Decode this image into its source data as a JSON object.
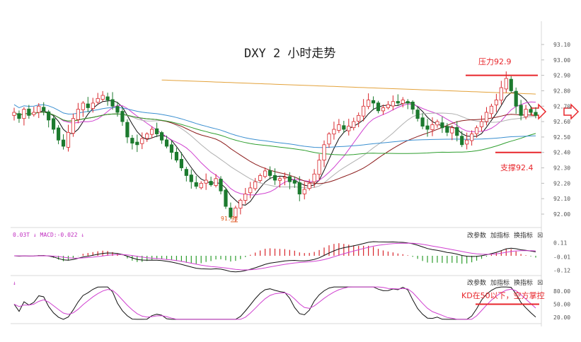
{
  "chart_data": {
    "type": "candlestick",
    "title": "DXY 2 小时走势",
    "yticks": [
      "93.10",
      "93.00",
      "92.90",
      "92.80",
      "92.70",
      "92.60",
      "92.50",
      "92.40",
      "92.30",
      "92.20",
      "92.10",
      "92.00"
    ],
    "ylim": [
      91.93,
      93.13
    ],
    "low_label": "91.95",
    "annotations": {
      "resistance": {
        "label": "压力92.9",
        "value": 92.9
      },
      "support": {
        "label": "支撑92.4",
        "value": 92.4
      },
      "kd_note": {
        "label": "KD在50以下，空方掌控",
        "value": 50
      }
    },
    "closes": [
      92.66,
      92.62,
      92.68,
      92.64,
      92.66,
      92.7,
      92.67,
      92.61,
      92.55,
      92.48,
      92.44,
      92.53,
      92.62,
      92.68,
      92.72,
      92.69,
      92.72,
      92.75,
      92.77,
      92.74,
      92.7,
      92.66,
      92.6,
      92.5,
      92.46,
      92.45,
      92.49,
      92.52,
      92.55,
      92.52,
      92.48,
      92.44,
      92.4,
      92.35,
      92.3,
      92.25,
      92.21,
      92.18,
      92.2,
      92.22,
      92.19,
      92.23,
      92.15,
      92.05,
      91.98,
      92.04,
      92.09,
      92.13,
      92.17,
      92.21,
      92.25,
      92.28,
      92.25,
      92.22,
      92.23,
      92.24,
      92.21,
      92.2,
      92.13,
      92.16,
      92.2,
      92.26,
      92.35,
      92.45,
      92.52,
      92.55,
      92.58,
      92.55,
      92.57,
      92.6,
      92.64,
      92.7,
      92.74,
      92.72,
      92.67,
      92.69,
      92.71,
      92.73,
      92.72,
      92.74,
      92.72,
      92.68,
      92.62,
      92.57,
      92.55,
      92.58,
      92.6,
      92.56,
      92.53,
      92.56,
      92.51,
      92.45,
      92.48,
      92.52,
      92.56,
      92.6,
      92.66,
      92.7,
      92.74,
      92.82,
      92.88,
      92.8,
      92.7,
      92.64,
      92.68,
      92.66,
      92.64
    ],
    "macd": {
      "label": "0.03T ↓ MACD:-0.022 ↓",
      "yticks": [
        "0.11",
        "-0.01",
        "-0.12"
      ],
      "ylim": [
        -0.13,
        0.13
      ]
    },
    "kd": {
      "label": "↓",
      "yticks": [
        "80.00",
        "50.00",
        "20.00"
      ],
      "ylim": [
        10,
        95
      ]
    },
    "controls": [
      "改参数",
      "加指标",
      "换指标",
      "☒"
    ]
  }
}
